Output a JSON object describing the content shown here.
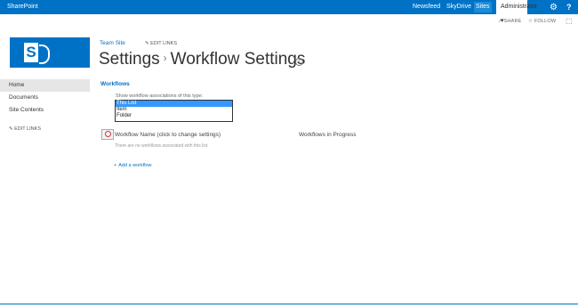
{
  "topbar": {
    "brand": "SharePoint",
    "links": [
      "Newsfeed",
      "SkyDrive",
      "Sites"
    ],
    "user": "Administrator ▾",
    "settings_icon": "⚙",
    "help_icon": "?"
  },
  "subbar": {
    "share": "SHARE",
    "follow": "FOLLOW",
    "focus_icon": "⬚"
  },
  "breadcrumb": {
    "site": "Team Site",
    "edit_links": "EDIT LINKS"
  },
  "page": {
    "title": "Settings",
    "separator": "›",
    "subtitle": "Workflow Settings",
    "info_icon": "i"
  },
  "nav": {
    "items": [
      "Home",
      "Documents",
      "Site Contents"
    ],
    "edit_links": "EDIT LINKS"
  },
  "workflows": {
    "heading": "Workflows",
    "show_label": "Show workflow associations of this type:",
    "options": [
      "This List",
      "Item",
      "Folder"
    ],
    "column_name": "Workflow Name (click to change settings)",
    "column_progress": "Workflows in Progress",
    "empty_message": "There are no workflows associated with this list.",
    "add_link": "Add a workflow"
  },
  "colors": {
    "accent": "#0072c6"
  }
}
